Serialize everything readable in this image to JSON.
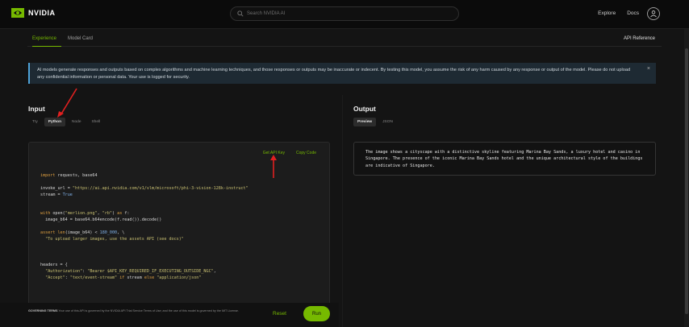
{
  "header": {
    "brand": "NVIDIA",
    "search_placeholder": "Search NVIDIA AI",
    "nav": [
      "Explore",
      "Docs"
    ]
  },
  "subtabs": {
    "items": [
      "Experience",
      "Model Card"
    ],
    "active": "Experience",
    "right_link": "API Reference"
  },
  "notice": {
    "text": "AI models generate responses and outputs based on complex algorithms and machine learning techniques, and those responses or outputs may be inaccurate or indecent. By testing this model, you assume the risk of any harm caused by any response or output of the model. Please do not upload any confidential information or personal data. Your use is logged for security.",
    "close": "×"
  },
  "input": {
    "title": "Input",
    "tabs": [
      "Try",
      "Python",
      "Node",
      "Shell"
    ],
    "active_tab": "Python",
    "actions": {
      "get_api_key": "Get API Key",
      "copy_code": "Copy Code"
    }
  },
  "code_lines": [
    "import requests, base64",
    "",
    "invoke_url = \"https://ai.api.nvidia.com/v1/vlm/microsoft/phi-3-vision-128k-instruct\"",
    "stream = True",
    "",
    "",
    "with open(\"merlion.png\", \"rb\") as f:",
    "  image_b64 = base64.b64encode(f.read()).decode()",
    "",
    "assert len(image_b64) < 180_000, \\",
    "  \"To upload larger images, use the assets API (see docs)\"",
    "",
    "",
    "",
    "headers = {",
    "  \"Authorization\": \"Bearer $API_KEY_REQUIRED_IF_EXECUTING_OUTSIDE_NGC\",",
    "  \"Accept\": \"text/event-stream\" if stream else \"application/json\""
  ],
  "footer": {
    "label": "GOVERNING TERMS",
    "text": "Your use of this API is governed by the NVIDIA API Trial Service Terms of Use; and the use of this model is governed by the MIT License.",
    "reset": "Reset",
    "run": "Run"
  },
  "output": {
    "title": "Output",
    "tabs": [
      "Preview",
      "JSON"
    ],
    "active_tab": "Preview",
    "text": "The image shows a cityscape with a distinctive skyline featuring Marina Bay Sands, a luxury hotel and casino in Singapore. The presence of the iconic Marina Bay Sands hotel and the unique architectural style of the buildings are indicative of Singapore."
  },
  "colors": {
    "accent": "#76b900",
    "annotation_arrow": "#e02020",
    "banner": "#1e2a33"
  },
  "icons": [
    "nvidia-logo-icon",
    "search-icon",
    "user-icon",
    "close-icon",
    "annotation-arrow-icon"
  ]
}
